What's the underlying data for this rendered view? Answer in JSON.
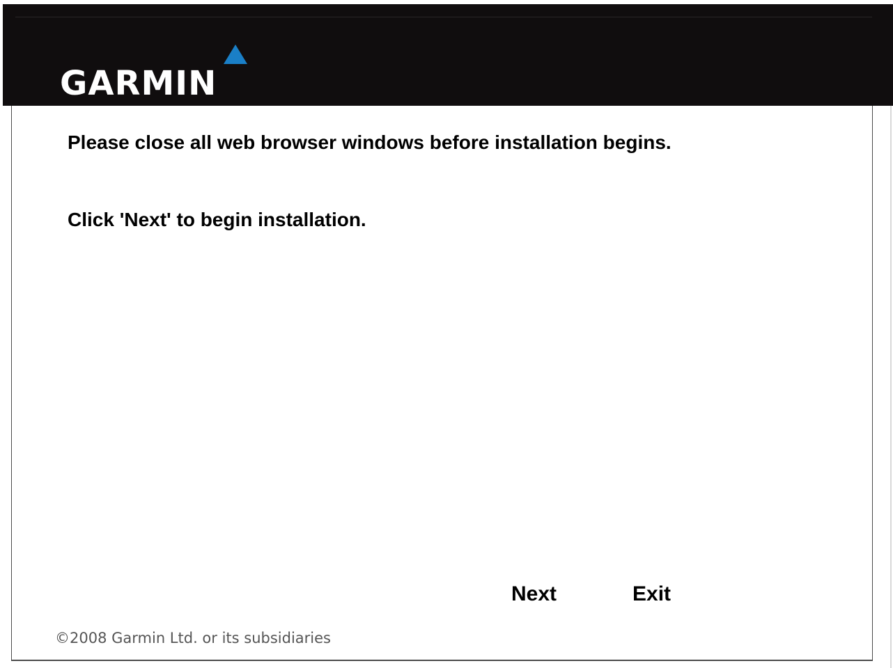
{
  "header": {
    "logo_text": "GARMIN",
    "logo_accent_color": "#1a7fc7",
    "background_color": "#100d0e"
  },
  "content": {
    "message_close_browsers": "Please close all web browser windows before installation begins.",
    "message_click_next": "Click 'Next' to begin installation."
  },
  "buttons": {
    "next_label": "Next",
    "exit_label": "Exit"
  },
  "footer": {
    "copyright": "©2008 Garmin Ltd. or its subsidiaries"
  }
}
